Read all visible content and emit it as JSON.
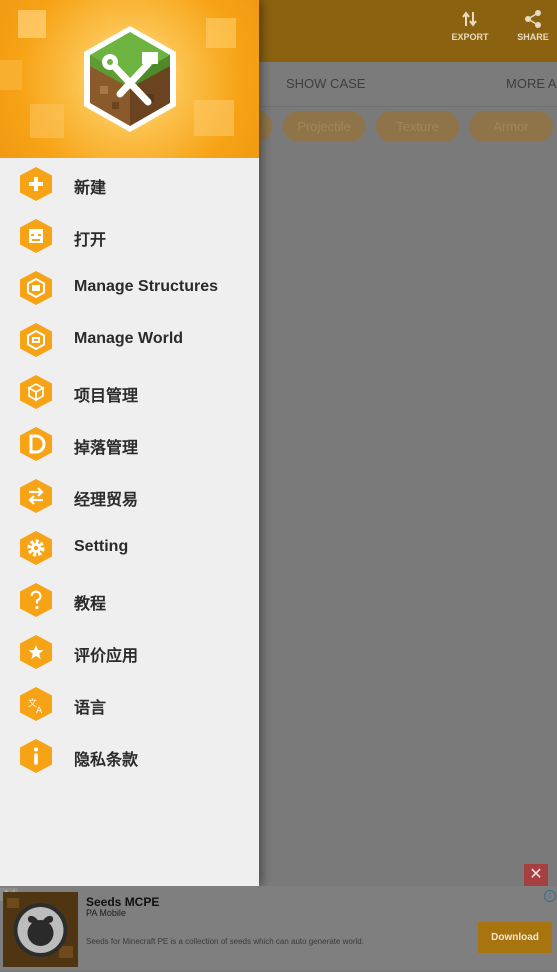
{
  "app_bar": {
    "actions": [
      {
        "label": "EXPORT",
        "icon": "sort-arrows-icon"
      },
      {
        "label": "SHARE",
        "icon": "share-icon"
      }
    ]
  },
  "tabs": [
    {
      "label": "SHOW CASE"
    },
    {
      "label": "MORE AD"
    }
  ],
  "chips": [
    {
      "label": "Projectile"
    },
    {
      "label": "Texture"
    },
    {
      "label": "Armor"
    }
  ],
  "drawer": {
    "header_icon": "grass-block-tools-logo",
    "items": [
      {
        "label": "新建",
        "icon": "plus-icon"
      },
      {
        "label": "打开",
        "icon": "folder-face-icon"
      },
      {
        "label": "Manage Structures",
        "icon": "structure-icon"
      },
      {
        "label": "Manage World",
        "icon": "world-icon"
      },
      {
        "label": "项目管理",
        "icon": "cube-icon"
      },
      {
        "label": "掉落管理",
        "icon": "letter-d-icon"
      },
      {
        "label": "经理贸易",
        "icon": "trade-arrows-icon"
      },
      {
        "label": "Setting",
        "icon": "gear-icon"
      },
      {
        "label": "教程",
        "icon": "question-icon"
      },
      {
        "label": "评价应用",
        "icon": "star-icon"
      },
      {
        "label": "语言",
        "icon": "translate-icon"
      },
      {
        "label": "隐私条款",
        "icon": "info-icon"
      }
    ]
  },
  "ad": {
    "tag": "Ad",
    "title": "Seeds MCPE",
    "publisher": "PA Mobile",
    "description": "Seeds for Minecraft PE is a collection of seeds which can auto generate world.",
    "cta": "Download",
    "close": "✕",
    "info": "i"
  },
  "colors": {
    "accent": "#f7a316",
    "drawer_bg": "#efefef",
    "scrim": "#7a7a7a"
  }
}
